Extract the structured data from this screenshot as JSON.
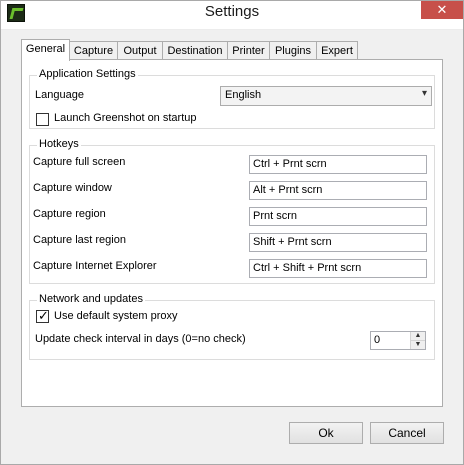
{
  "window": {
    "title": "Settings",
    "close_symbol": "✕"
  },
  "tabs": [
    "General",
    "Capture",
    "Output",
    "Destination",
    "Printer",
    "Plugins",
    "Expert"
  ],
  "application_settings": {
    "heading": "Application Settings",
    "language_label": "Language",
    "language_value": "English",
    "launch_label": "Launch Greenshot on startup",
    "launch_checked": false
  },
  "hotkeys": {
    "heading": "Hotkeys",
    "rows": [
      {
        "label": "Capture full screen",
        "value": "Ctrl + Prnt scrn"
      },
      {
        "label": "Capture window",
        "value": "Alt + Prnt scrn"
      },
      {
        "label": "Capture region",
        "value": "Prnt scrn"
      },
      {
        "label": "Capture last region",
        "value": "Shift + Prnt scrn"
      },
      {
        "label": "Capture Internet Explorer",
        "value": "Ctrl + Shift + Prnt scrn"
      }
    ]
  },
  "network": {
    "heading": "Network and updates",
    "proxy_label": "Use default system proxy",
    "proxy_checked": true,
    "update_label": "Update check interval in days (0=no check)",
    "update_value": "0"
  },
  "buttons": {
    "ok": "Ok",
    "cancel": "Cancel"
  },
  "icons": {
    "app": "greenshot-app-icon",
    "close": "close-icon",
    "dropdown": "chevron-down-icon"
  }
}
